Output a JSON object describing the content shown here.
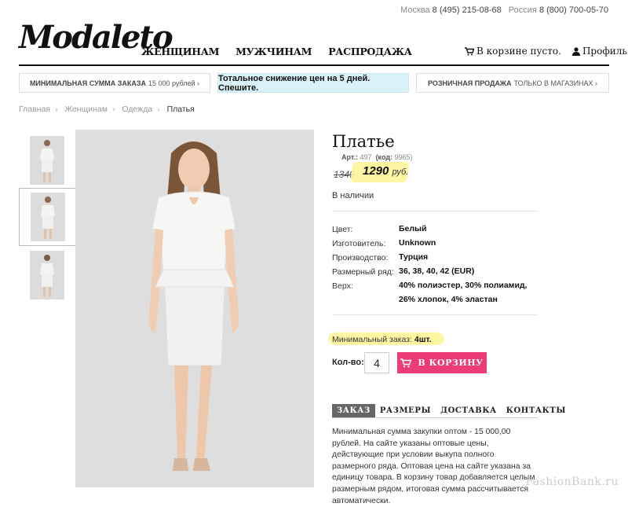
{
  "topbar": {
    "moscow_label": "Москва",
    "moscow_phone": "8 (495) 215-08-68",
    "russia_label": "Россия",
    "russia_phone": "8 (800) 700-05-70"
  },
  "logo": "Modaleto",
  "nav": [
    "ЖЕНЩИНАМ",
    "МУЖЧИНАМ",
    "РАСПРОДАЖА"
  ],
  "header": {
    "cart_text": "В корзине пусто.",
    "profile_text": "Профиль"
  },
  "promos": {
    "left_bold": "МИНИМАЛЬНАЯ СУММА ЗАКАЗА",
    "left_rest": "15 000 рублей ›",
    "center": "Тотальное снижение цен на 5 дней. Спешите.",
    "right_bold": "РОЗНИЧНАЯ ПРОДАЖА",
    "right_rest": "ТОЛЬКО В МАГАЗИНАХ ›"
  },
  "breadcrumbs": [
    "Главная",
    "Женщинам",
    "Одежда",
    "Платья"
  ],
  "product": {
    "title": "Платье",
    "art_label": "Арт.:",
    "art_value": "497",
    "code_label": "(код:",
    "code_value": "9965)",
    "old_price": "1340",
    "price": "1290",
    "currency": "руб.",
    "stock": "В наличии",
    "specs": [
      {
        "label": "Цвет:",
        "value": "Белый"
      },
      {
        "label": "Изготовитель:",
        "value": "Unknown"
      },
      {
        "label": "Производство:",
        "value": "Турция"
      },
      {
        "label": "Размерный ряд:",
        "value": "36, 38, 40, 42 (EUR)"
      },
      {
        "label": "Верх:",
        "value": "40% полиэстер, 30% полиамид,"
      },
      {
        "label": "",
        "value": "26% хлопок, 4% эластан"
      }
    ],
    "min_order_label": "Минимальный заказ:",
    "min_order_value": "4шт.",
    "qty_label": "Кол-во:",
    "qty_value": "4",
    "add_to_cart": "В КОРЗИНУ"
  },
  "tabs": [
    "ЗАКАЗ",
    "РАЗМЕРЫ",
    "ДОСТАВКА",
    "КОНТАКТЫ"
  ],
  "description": "Минимальная сумма закупки оптом - 15 000,00 рублей. На сайте указаны оптовые цены, действующие при условии выкупа полного размерного ряда. Оптовая цена на сайте указана за единицу товара. В корзину товар добавляется целым размерным рядом, итоговая сумма рассчитывается автоматически.",
  "watermark": "FashionBank.ru",
  "colors": {
    "accent": "#ec3b78",
    "promo_bg": "#d9f1f8",
    "highlight": "#fff59a"
  }
}
